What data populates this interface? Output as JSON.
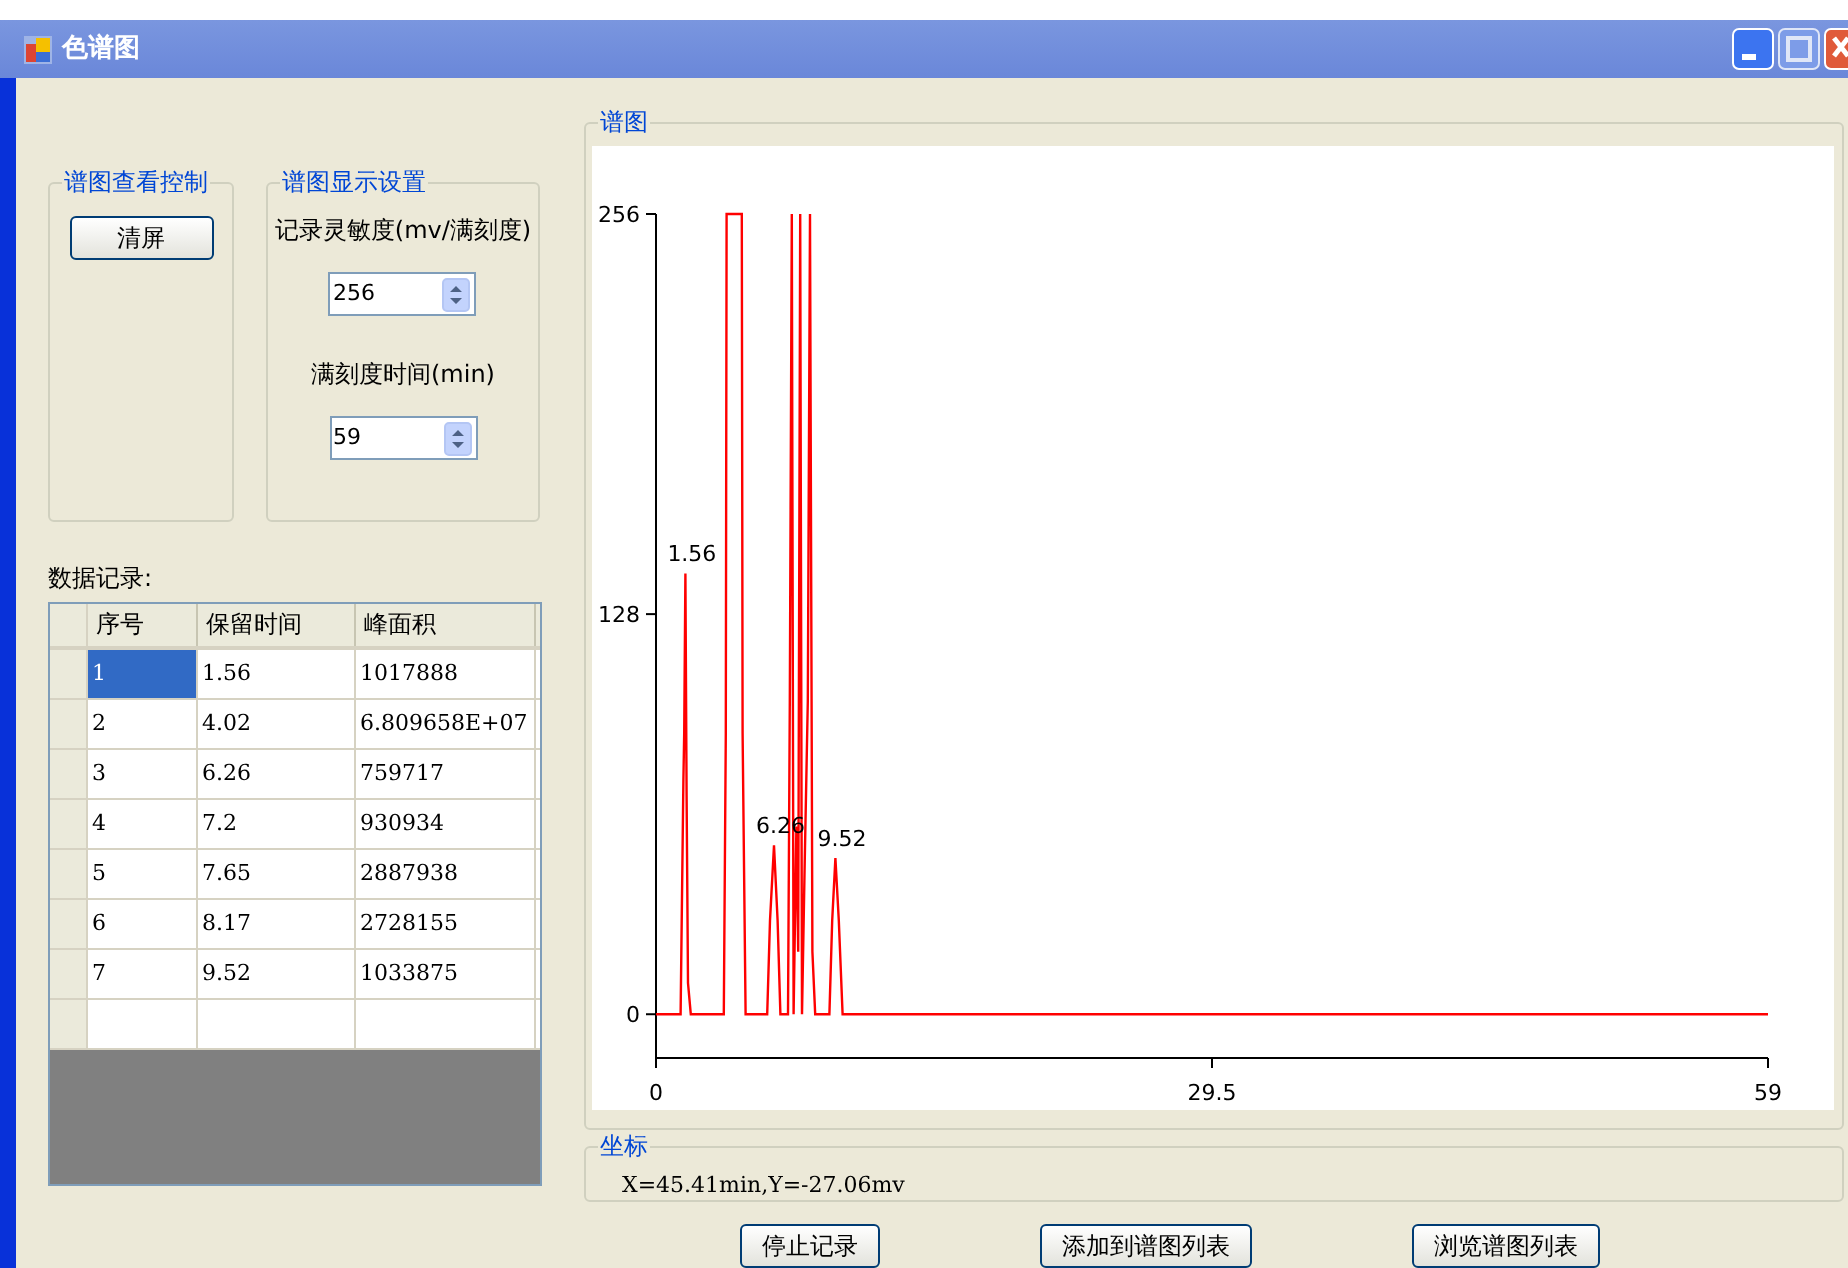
{
  "window": {
    "title": "色谱图"
  },
  "view_control": {
    "title": "谱图查看控制",
    "button": "清屏"
  },
  "display_settings": {
    "title": "谱图显示设置",
    "spinners": [
      {
        "label": "记录灵敏度(mv/满刻度)",
        "value": "256"
      },
      {
        "label": "满刻度时间(min)",
        "value": "59"
      }
    ]
  },
  "records": {
    "title": "数据记录:",
    "columns": [
      "序号",
      "保留时间",
      "峰面积"
    ],
    "rows": [
      [
        {
          "text": "1",
          "selected": true
        },
        {
          "text": "1.56",
          "selected": false
        },
        {
          "text": "1017888",
          "selected": false
        }
      ],
      [
        {
          "text": "2",
          "selected": false
        },
        {
          "text": "4.02",
          "selected": false
        },
        {
          "text": "6.809658E+07",
          "selected": false
        }
      ],
      [
        {
          "text": "3",
          "selected": false
        },
        {
          "text": "6.26",
          "selected": false
        },
        {
          "text": "759717",
          "selected": false
        }
      ],
      [
        {
          "text": "4",
          "selected": false
        },
        {
          "text": "7.2",
          "selected": false
        },
        {
          "text": "930934",
          "selected": false
        }
      ],
      [
        {
          "text": "5",
          "selected": false
        },
        {
          "text": "7.65",
          "selected": false
        },
        {
          "text": "2887938",
          "selected": false
        }
      ],
      [
        {
          "text": "6",
          "selected": false
        },
        {
          "text": "8.17",
          "selected": false
        },
        {
          "text": "2728155",
          "selected": false
        }
      ],
      [
        {
          "text": "7",
          "selected": false
        },
        {
          "text": "9.52",
          "selected": false
        },
        {
          "text": "1033875",
          "selected": false
        }
      ]
    ]
  },
  "chromatogram": {
    "title": "谱图",
    "chart_data": {
      "type": "line",
      "xlim": [
        0,
        59
      ],
      "ylim": [
        -14,
        256
      ],
      "xticks": [
        0,
        29.5,
        59
      ],
      "yticks": [
        0,
        128,
        256
      ],
      "x": [
        0,
        1.3,
        1.45,
        1.5,
        1.56,
        1.62,
        1.7,
        1.85,
        3.6,
        3.7,
        3.75,
        4.55,
        4.6,
        4.75,
        5.9,
        6.05,
        6.26,
        6.45,
        6.6,
        7.0,
        7.1,
        7.2,
        7.3,
        7.45,
        7.55,
        7.65,
        7.75,
        7.9,
        8.05,
        8.17,
        8.3,
        8.45,
        9.2,
        9.35,
        9.52,
        9.7,
        9.9,
        59
      ],
      "series": [
        {
          "color": "#ff0000",
          "values": [
            0,
            0,
            75,
            90,
            141,
            70,
            10,
            0,
            0,
            90,
            256,
            256,
            90,
            0,
            0,
            30,
            54,
            30,
            0,
            0,
            100,
            256,
            0,
            60,
            20,
            256,
            0,
            50,
            100,
            256,
            20,
            0,
            0,
            30,
            50,
            30,
            0,
            0
          ]
        }
      ],
      "annotations": [
        {
          "x": 1.56,
          "y": 141,
          "text": "1.56"
        },
        {
          "x": 6.26,
          "y": 54,
          "text": "6.26"
        },
        {
          "x": 9.52,
          "y": 50,
          "text": "9.52"
        }
      ]
    }
  },
  "coordinates": {
    "title": "坐标",
    "text": "X=45.41min,Y=-27.06mv"
  },
  "buttons": [
    "停止记录",
    "添加到谱图列表",
    "浏览谱图列表"
  ]
}
